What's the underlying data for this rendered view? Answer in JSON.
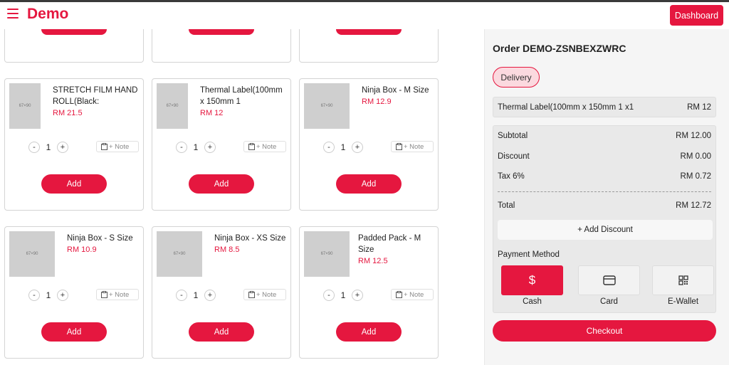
{
  "header": {
    "brand": "Demo",
    "dashboard_label": "Dashboard"
  },
  "thumb_label": "67×90",
  "note_label": "+ Note",
  "add_label": "Add",
  "products": [
    {
      "name": "STRETCH FILM HAND ROLL(Black:",
      "price": "RM 21.5",
      "qty": "1"
    },
    {
      "name": "Thermal Label(100mm x 150mm 1",
      "price": "RM 12",
      "qty": "1"
    },
    {
      "name": "Ninja Box - M Size",
      "price": "RM 12.9",
      "qty": "1"
    },
    {
      "name": "Ninja Box - S Size",
      "price": "RM 10.9",
      "qty": "1"
    },
    {
      "name": "Ninja Box - XS Size",
      "price": "RM 8.5",
      "qty": "1"
    },
    {
      "name": "Padded Pack - M Size",
      "price": "RM 12.5",
      "qty": "1"
    }
  ],
  "order": {
    "title": "Order DEMO-ZSNBEXZWRC",
    "type_label": "Delivery",
    "item": {
      "name": "Thermal Label(100mm x 150mm 1 x1",
      "price": "RM 12"
    },
    "subtotal_label": "Subtotal",
    "subtotal": "RM 12.00",
    "discount_label": "Discount",
    "discount": "RM 0.00",
    "tax_label": "Tax 6%",
    "tax": "RM 0.72",
    "total_label": "Total",
    "total": "RM 12.72",
    "add_discount_label": "+ Add Discount",
    "payment_label": "Payment Method",
    "methods": [
      {
        "name": "Cash",
        "icon": "dollar-icon"
      },
      {
        "name": "Card",
        "icon": "card-icon"
      },
      {
        "name": "E-Wallet",
        "icon": "qr-icon"
      }
    ],
    "checkout_label": "Checkout"
  },
  "colors": {
    "accent": "#e5173f",
    "panel_bg": "#f5f5f5"
  }
}
